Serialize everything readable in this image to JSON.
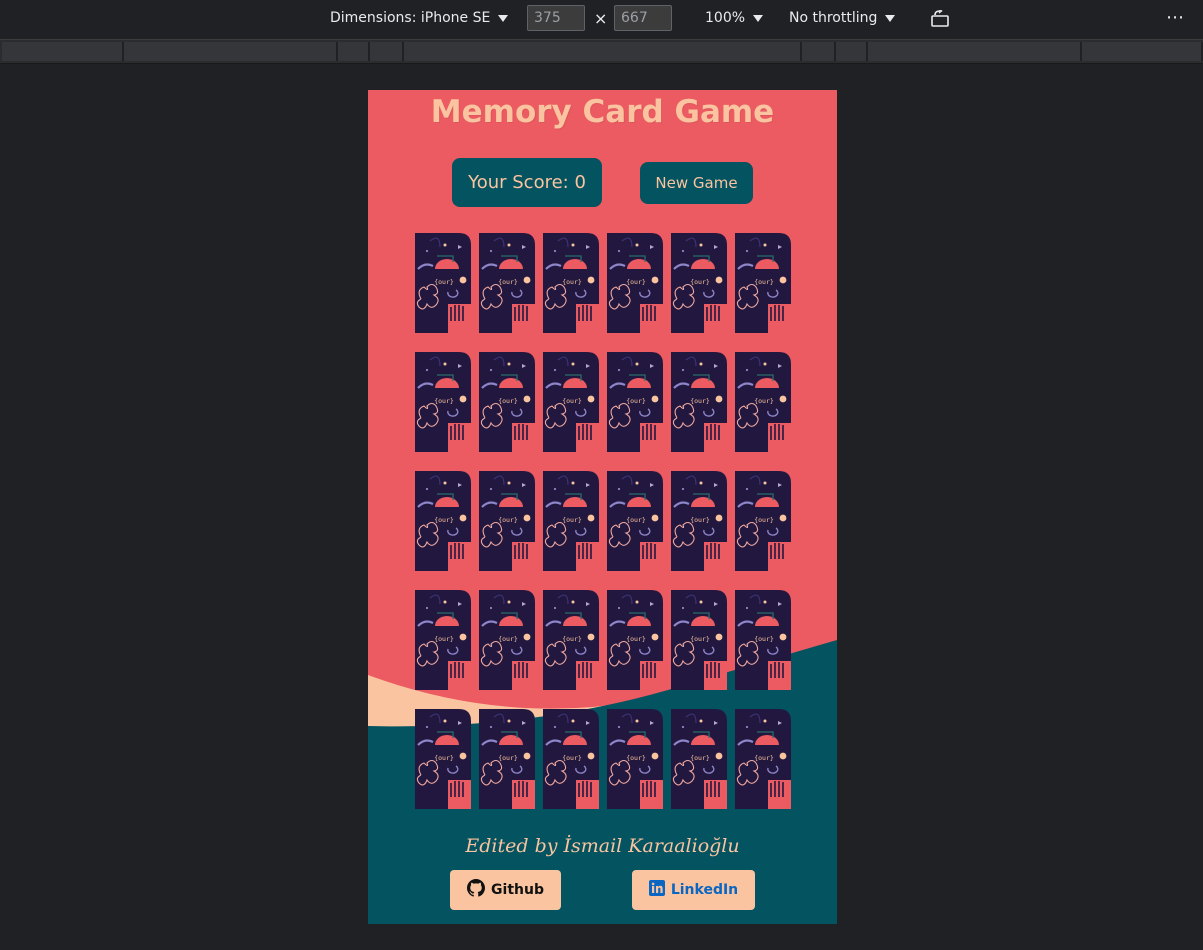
{
  "devtools": {
    "dimensions_label": "Dimensions: iPhone SE",
    "width_value": "375",
    "height_value": "667",
    "times_symbol": "×",
    "zoom_label": "100%",
    "throttling_label": "No throttling",
    "more_label": "⋯",
    "icons": [
      "chevron-down-icon",
      "rotate-icon",
      "more-icon"
    ]
  },
  "app": {
    "title": "Memory Card Game",
    "score_label": "Your Score: 0",
    "new_game_label": "New Game",
    "card_count": 30,
    "card_back_text": "{our}",
    "footer_text": "Edited by İsmail Karaalioğlu",
    "github_label": "Github",
    "linkedin_label": "LinkedIn",
    "icons": [
      "github-icon",
      "linkedin-icon"
    ]
  },
  "colors": {
    "background_red": "#ec5a62",
    "accent_teal": "#045360",
    "peach": "#f9c49f",
    "card_navy": "#22183f",
    "devtools_bg": "#202124"
  }
}
